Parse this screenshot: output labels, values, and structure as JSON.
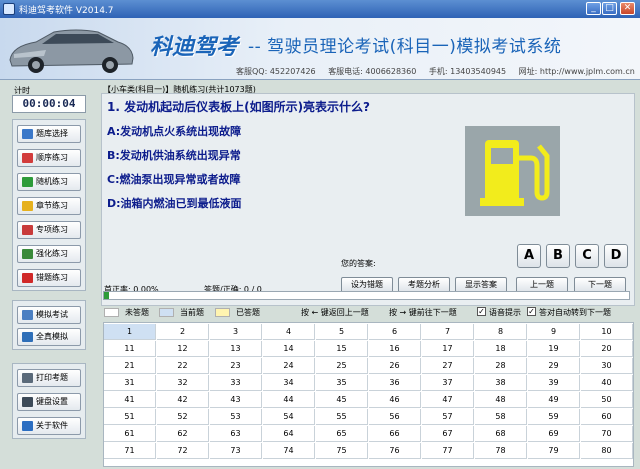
{
  "window": {
    "title": "科迪驾考软件 V2014.7"
  },
  "header": {
    "logo": "科迪驾考",
    "subtitle": "-- 驾驶员理论考试(科目一)模拟考试系统",
    "contact": [
      "客服QQ: 452207426",
      "客服电话: 4006628360",
      "手机: 13403540945",
      "网址: http://www.jplm.com.cn"
    ]
  },
  "timer": {
    "label": "计时",
    "value": "00:00:04"
  },
  "sidebar": {
    "group1": [
      {
        "label": "题库选择",
        "icon": "book-icon",
        "color": "#3b78c9"
      },
      {
        "label": "顺序练习",
        "icon": "edit-icon",
        "color": "#d23c3c"
      },
      {
        "label": "随机练习",
        "icon": "shuffle-icon",
        "color": "#2e9b3a"
      },
      {
        "label": "章节练习",
        "icon": "folder-icon",
        "color": "#e6b11e"
      },
      {
        "label": "专项练习",
        "icon": "check-list-icon",
        "color": "#c83a3a"
      },
      {
        "label": "强化练习",
        "icon": "list-icon",
        "color": "#3a8a3a"
      },
      {
        "label": "错题练习",
        "icon": "flag-icon",
        "color": "#d02828"
      }
    ],
    "group2": [
      {
        "label": "模拟考试",
        "icon": "document-icon",
        "color": "#4b7fc2"
      },
      {
        "label": "全真模拟",
        "icon": "monitor-icon",
        "color": "#2f6fb8"
      }
    ],
    "group3": [
      {
        "label": "打印考题",
        "icon": "printer-icon",
        "color": "#5a6a7a"
      },
      {
        "label": "键盘设置",
        "icon": "keyboard-icon",
        "color": "#3c4a58"
      },
      {
        "label": "关于软件",
        "icon": "info-icon",
        "color": "#2b6ec2"
      }
    ]
  },
  "question": {
    "header": "【小车类(科目一)】随机练习(共计1073题)",
    "text": "1. 发动机起动后仪表板上(如图所示)亮表示什么?",
    "options": [
      "A:发动机点火系统出现故障",
      "B:发动机供油系统出现异常",
      "C:燃油泵出现异常或者故障",
      "D:油箱内燃油已到最低液面"
    ],
    "image_icon": "fuel-pump-icon",
    "image_color": "#f2ec1c",
    "your_answer_label": "您的答案:",
    "answer_buttons": [
      "A",
      "B",
      "C",
      "D"
    ]
  },
  "stats": {
    "accuracy": "首正率: 0.00%",
    "answered": "答题/正确: 0 / 0"
  },
  "actions": [
    "设为错题",
    "考题分析",
    "显示答案",
    "上一题",
    "下一题"
  ],
  "progress": 0.01,
  "legend": {
    "unanswered": "未答题",
    "current": "当前题",
    "answered": "已答题",
    "prev_hint": "按 ← 键返回上一题",
    "next_hint": "按 → 键前往下一题",
    "voice_prompt": "语音提示",
    "auto_next": "答对自动转到下一题"
  },
  "grid": {
    "rows": [
      [
        "1",
        "2",
        "3",
        "4",
        "5",
        "6",
        "7",
        "8",
        "9",
        "10"
      ],
      [
        "11",
        "12",
        "13",
        "14",
        "15",
        "16",
        "17",
        "18",
        "19",
        "20"
      ],
      [
        "21",
        "22",
        "23",
        "24",
        "25",
        "26",
        "27",
        "28",
        "29",
        "30"
      ],
      [
        "31",
        "32",
        "33",
        "34",
        "35",
        "36",
        "37",
        "38",
        "39",
        "40"
      ],
      [
        "41",
        "42",
        "43",
        "44",
        "45",
        "46",
        "47",
        "48",
        "49",
        "50"
      ],
      [
        "51",
        "52",
        "53",
        "54",
        "55",
        "56",
        "57",
        "58",
        "59",
        "60"
      ],
      [
        "61",
        "62",
        "63",
        "64",
        "65",
        "66",
        "67",
        "68",
        "69",
        "70"
      ],
      [
        "71",
        "72",
        "73",
        "74",
        "75",
        "76",
        "77",
        "78",
        "79",
        "80"
      ]
    ],
    "current": "1"
  },
  "colors": {
    "unanswered": "#ffffff",
    "current": "#cfe0f3",
    "answered": "#fff4b0",
    "question_text": "#0c1c8c"
  }
}
